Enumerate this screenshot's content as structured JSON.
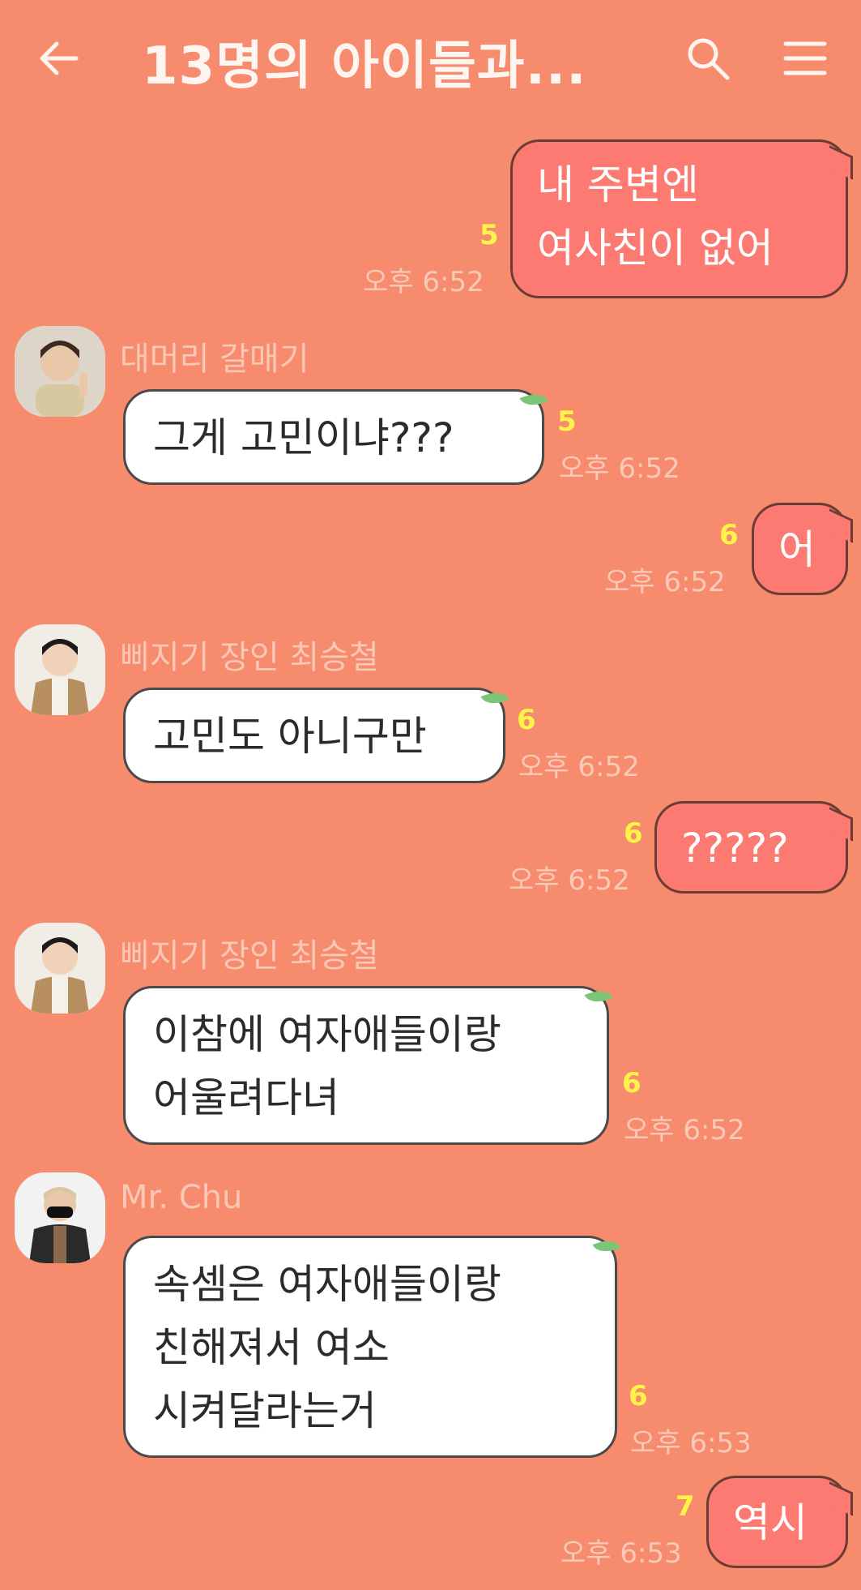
{
  "header": {
    "title": "13명의 아이들과...",
    "back_icon": "back-arrow-icon",
    "search_icon": "search-icon",
    "menu_icon": "hamburger-menu-icon"
  },
  "colors": {
    "background": "#F68C6D",
    "outgoing_bubble": "#FC7A72",
    "incoming_bubble": "#ffffff",
    "unread": "#FFF34A"
  },
  "messages": [
    {
      "direction": "out",
      "text": "내 주변엔\n여사친이 없어",
      "unread": "5",
      "time": "오후 6:52"
    },
    {
      "direction": "in",
      "sender": "대머리 갈매기",
      "text": "그게 고민이냐???",
      "unread": "5",
      "time": "오후 6:52"
    },
    {
      "direction": "out",
      "text": "어",
      "unread": "6",
      "time": "오후 6:52"
    },
    {
      "direction": "in",
      "sender": "삐지기 장인 최승철",
      "text": "고민도 아니구만",
      "unread": "6",
      "time": "오후 6:52"
    },
    {
      "direction": "out",
      "text": "?????",
      "unread": "6",
      "time": "오후 6:52"
    },
    {
      "direction": "in",
      "sender": "삐지기 장인 최승철",
      "text": "이참에 여자애들이랑\n어울려다녀",
      "unread": "6",
      "time": "오후 6:52"
    },
    {
      "direction": "in",
      "sender": "Mr. Chu",
      "text": "속셈은 여자애들이랑\n친해져서 여소\n시켜달라는거",
      "unread": "6",
      "time": "오후 6:53"
    },
    {
      "direction": "out",
      "text": "역시",
      "unread": "7",
      "time": "오후 6:53"
    }
  ]
}
